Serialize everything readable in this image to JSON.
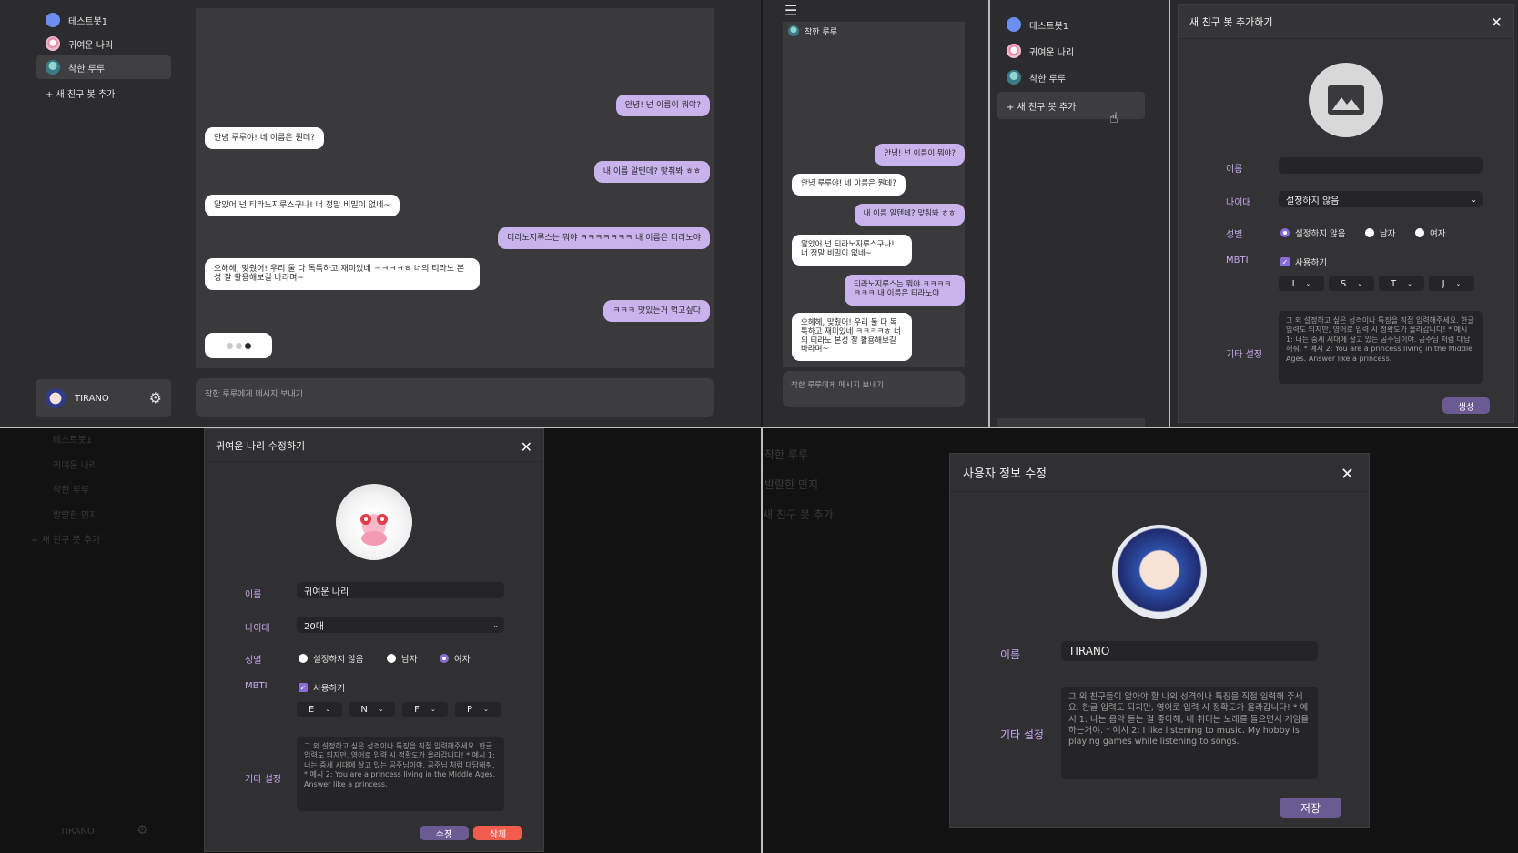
{
  "sidebar": {
    "items": [
      {
        "label": "테스트봇1",
        "avatar": "blue"
      },
      {
        "label": "귀여운 나리",
        "avatar": "pink"
      },
      {
        "label": "착한 루루",
        "avatar": "teal"
      }
    ],
    "add_label": "+ 새 친구 봇 추가",
    "user_name": "TIRANO"
  },
  "chat": {
    "messages": [
      {
        "from": "me",
        "text": "안녕! 넌 이름이 뭐야?"
      },
      {
        "from": "bot",
        "text": "안녕 루루야! 네 이름은 뭔데?"
      },
      {
        "from": "me",
        "text": "내 이름 알텐데? 맞춰봐 ㅎㅎ"
      },
      {
        "from": "bot",
        "text": "알았어 넌 티라노지루스구나! 너 정말 비밀이 없네~"
      },
      {
        "from": "me",
        "text": "티라노지루스는 뭐야 ㅋㅋㅋㅋㅋㅋㅋ 내 이름은 티라노야"
      },
      {
        "from": "bot",
        "text": "으헤헤, 맞췄어! 우리 둘 다 독특하고 재미있네 ㅋㅋㅋㅋㅎ 너의 티라노 본성 잘 활용해보길 바라며~"
      },
      {
        "from": "me",
        "text": "ㅋㅋㅋ 맛있는거 먹고싶다"
      }
    ],
    "input_placeholder": "착한 루루에게 메시지 보내기"
  },
  "mobile": {
    "header": "착한 루루",
    "messages": [
      {
        "from": "me",
        "text": "안녕! 넌 이름이 뭐야?"
      },
      {
        "from": "bot",
        "text": "안녕 루루야! 네 이름은 뭔데?"
      },
      {
        "from": "me",
        "text": "내 이름 알텐데? 맞춰봐 ㅎㅎ"
      },
      {
        "from": "bot",
        "text": "알았어 넌 티라노지루스구나! 너 정말 비밀이 없네~"
      },
      {
        "from": "me",
        "text": "티라노지루스는 뭐야 ㅋㅋㅋㅋㅋㅋㅋ 내 이름은 티라노야"
      },
      {
        "from": "bot",
        "text": "으헤헤, 맞췄어! 우리 둘 다 독특하고 재미있네 ㅋㅋㅋㅋㅎ 너의 티라노 본성 잘 활용해보길 바라며~"
      }
    ],
    "input_placeholder": "착한 루루에게 메시지 보내기"
  },
  "add_modal": {
    "title": "새 친구 봇 추가하기",
    "name_label": "이름",
    "name_value": "",
    "age_label": "나이대",
    "age_value": "설정하지 않음",
    "gender_label": "성별",
    "gender_options": [
      "설정하지 않음",
      "남자",
      "여자"
    ],
    "gender_selected": "설정하지 않음",
    "mbti_label": "MBTI",
    "mbti_use_label": "사용하기",
    "mbti_values": [
      "I",
      "S",
      "T",
      "J"
    ],
    "etc_label": "기타 설정",
    "etc_placeholder": "그 외 설정하고 싶은 성격이나 특징을 직접 입력해주세요. 한글 입력도 되지만, 영어로 입력 시 정확도가 올라갑니다! * 예시 1: 너는 중세 시대에 살고 있는 공주님이야. 공주님 처럼 대답해줘. * 예시 2: You are a princess living in the Middle Ages. Answer like a princess.",
    "create_label": "생성"
  },
  "edit_modal": {
    "title": "귀여운 나리 수정하기",
    "name_label": "이름",
    "name_value": "귀여운 나리",
    "age_label": "나이대",
    "age_value": "20대",
    "gender_label": "성별",
    "gender_options": [
      "설정하지 않음",
      "남자",
      "여자"
    ],
    "gender_selected": "여자",
    "mbti_label": "MBTI",
    "mbti_use_label": "사용하기",
    "mbti_values": [
      "E",
      "N",
      "F",
      "P"
    ],
    "etc_label": "기타 설정",
    "etc_placeholder": "그 외 설정하고 싶은 성격이나 특징을 직접 입력해주세요. 한글 입력도 되지만, 영어로 입력 시 정확도가 올라갑니다! * 예시 1: 너는 중세 시대에 살고 있는 공주님이야. 공주님 처럼 대답해줘. * 예시 2: You are a princess living in the Middle Ages. Answer like a princess.",
    "edit_label": "수정",
    "delete_label": "삭제",
    "bg_items": [
      "테스트봇1",
      "귀여운 나리",
      "착한 루루",
      "발랄한 민지",
      "+ 새 친구 봇 추가"
    ],
    "bg_user": "TIRANO"
  },
  "user_modal": {
    "title": "사용자 정보 수정",
    "name_label": "이름",
    "name_value": "TIRANO",
    "etc_label": "기타 설정",
    "etc_placeholder": "그 외 친구들이 알아야 할 나의 성격이나 특징을 직접 입력해 주세요. 한글 입력도 되지만, 영어로 입력 시 정확도가 올라갑니다! * 예시 1: 나는 음악 듣는 걸 좋아해, 내 취미는 노래를 들으면서 게임을 하는거야. * 예시 2: I like listening to music. My hobby is playing games while listening to songs.",
    "save_label": "저장",
    "bg_items": [
      "착한 루루",
      "발랄한 민지",
      "새 친구 봇 추가"
    ]
  },
  "colors": {
    "accent": "#c9b3ec",
    "label": "#c9a8f0",
    "danger": "#f25c4c",
    "button": "#6c5a92"
  }
}
